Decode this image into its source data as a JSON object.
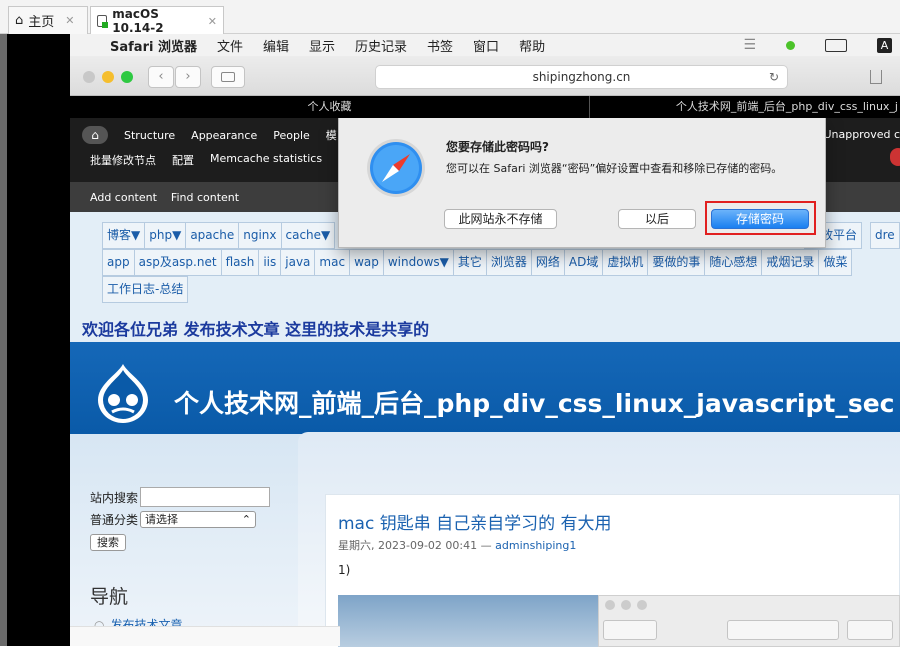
{
  "vm_tabs": [
    {
      "label": "主页",
      "icon": "home-icon"
    },
    {
      "label": "macOS 10.14-2",
      "icon": "vm-icon"
    }
  ],
  "menubar": {
    "app_name": "Safari 浏览器",
    "items": [
      "文件",
      "编辑",
      "显示",
      "历史记录",
      "书签",
      "窗口",
      "帮助"
    ],
    "input_indicator": "A"
  },
  "toolbar": {
    "url": "shipingzhong.cn"
  },
  "browser_tabs": [
    "个人收藏",
    "个人技术网_前端_后台_php_div_css_linux_j"
  ],
  "admin_menu": {
    "row1": [
      "Structure",
      "Appearance",
      "People",
      "模"
    ],
    "row2": [
      "批量修改节点",
      "配置",
      "Memcache statistics"
    ],
    "right_text": "Unapproved c"
  },
  "shortcuts": [
    "Add content",
    "Find content"
  ],
  "top_links": {
    "row1": [
      "博客▼",
      "php▼",
      "apache",
      "nginx",
      "cache▼"
    ],
    "row1_right": [
      "开放平台",
      "dre"
    ],
    "row2": [
      "app",
      "asp及asp.net",
      "flash",
      "iis",
      "java",
      "mac",
      "wap",
      "windows▼",
      "其它",
      "浏览器",
      "网络",
      "AD域",
      "虚拟机",
      "要做的事",
      "随心感想",
      "戒烟记录",
      "做菜"
    ],
    "row3": [
      "工作日志-总结"
    ]
  },
  "welcome_text": "欢迎各位兄弟 发布技术文章 这里的技术是共享的",
  "site_title": "个人技术网_前端_后台_php_div_css_linux_javascript_sec",
  "sidebar": {
    "search_label": "站内搜索",
    "category_label": "普通分类",
    "category_value": "请选择",
    "search_button": "搜索",
    "nav_title": "导航",
    "nav_item": "发布技术文章"
  },
  "article": {
    "title": "mac 钥匙串 自己亲自学习的 有大用",
    "date": "星期六, 2023-09-02 00:41",
    "separator": "—",
    "author": "adminshiping1",
    "body": "1)"
  },
  "dialog": {
    "title": "您要存储此密码吗?",
    "message": "您可以在 Safari 浏览器“密码”偏好设置中查看和移除已存储的密码。",
    "never_button": "此网站永不存储",
    "later_button": "以后",
    "save_button": "存储密码"
  },
  "colors": {
    "accent_blue": "#1a7ff0",
    "highlight_red": "#e12020",
    "banner_blue": "#1568b8"
  }
}
